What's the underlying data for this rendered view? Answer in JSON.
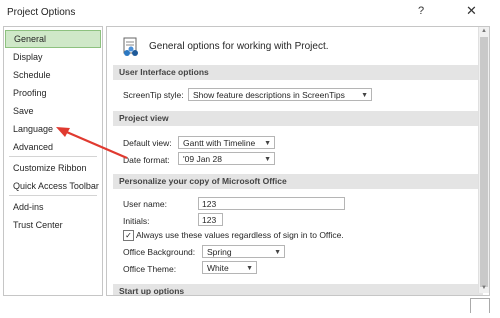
{
  "window": {
    "title": "Project Options",
    "help_glyph": "?",
    "close_glyph": "✕"
  },
  "sidebar": {
    "items": [
      {
        "label": "General",
        "selected": true
      },
      {
        "label": "Display"
      },
      {
        "label": "Schedule"
      },
      {
        "label": "Proofing"
      },
      {
        "label": "Save"
      },
      {
        "label": "Language"
      },
      {
        "label": "Advanced"
      },
      {
        "label": "Customize Ribbon"
      },
      {
        "label": "Quick Access Toolbar"
      },
      {
        "label": "Add-ins"
      },
      {
        "label": "Trust Center"
      }
    ]
  },
  "content": {
    "header": "General options for working with Project.",
    "sections": {
      "ui": "User Interface options",
      "project_view": "Project view",
      "personalize": "Personalize your copy of Microsoft Office",
      "startup": "Start up options"
    },
    "screentip": {
      "label": "ScreenTip style:",
      "value": "Show feature descriptions in ScreenTips"
    },
    "default_view": {
      "label": "Default view:",
      "value": "Gantt with Timeline"
    },
    "date_format": {
      "label": "Date format:",
      "value": "'09 Jan 28"
    },
    "user_name": {
      "label": "User name:",
      "value": "123"
    },
    "initials": {
      "label": "Initials:",
      "value": "123"
    },
    "always_use": {
      "label": "Always use these values regardless of sign in to Office.",
      "checked": true
    },
    "office_background": {
      "label": "Office Background:",
      "value": "Spring"
    },
    "office_theme": {
      "label": "Office Theme:",
      "value": "White"
    }
  },
  "annotation": {
    "color": "#e03a30"
  }
}
